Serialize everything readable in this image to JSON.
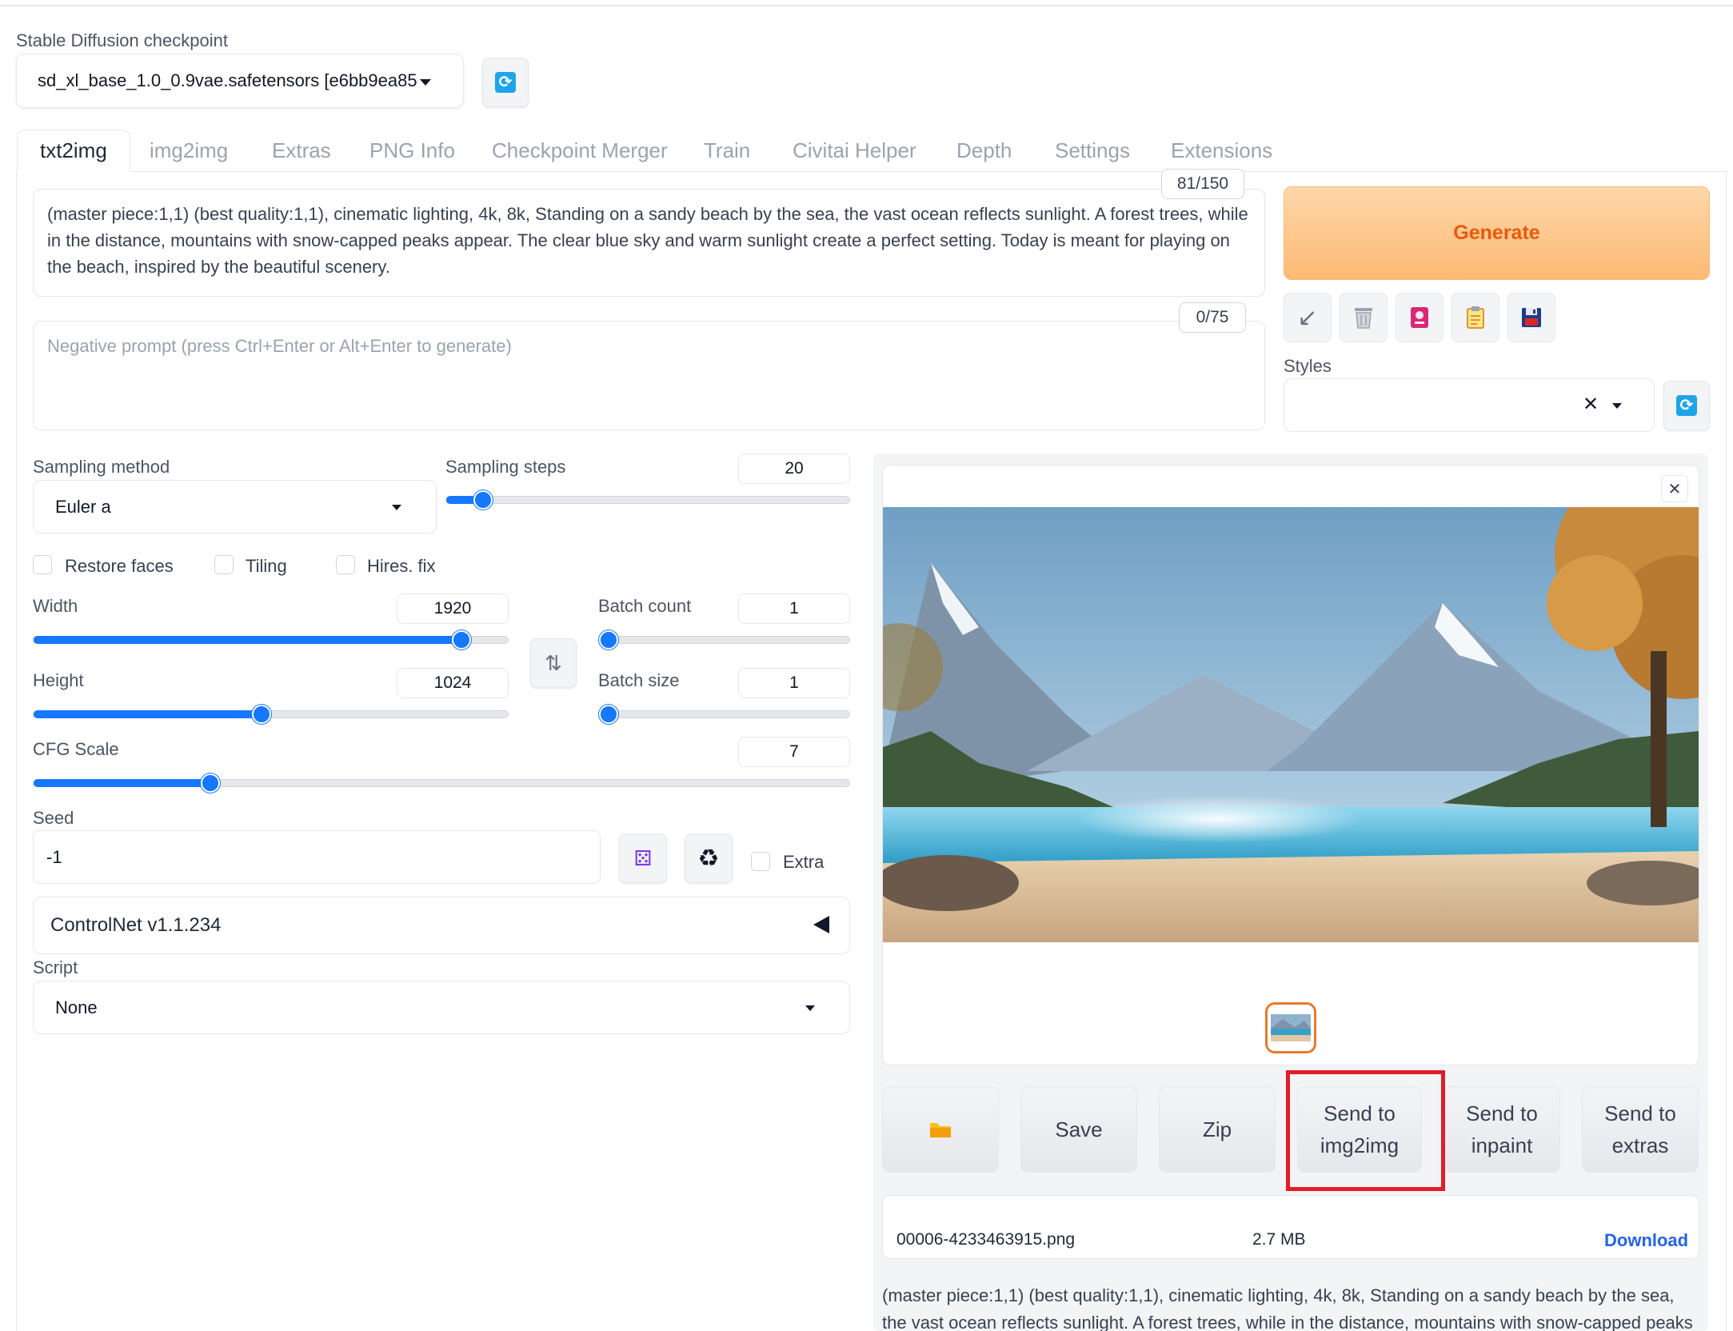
{
  "checkpoint": {
    "label": "Stable Diffusion checkpoint",
    "value": "sd_xl_base_1.0_0.9vae.safetensors [e6bb9ea85"
  },
  "tabs": [
    {
      "label": "txt2img",
      "active": true
    },
    {
      "label": "img2img"
    },
    {
      "label": "Extras"
    },
    {
      "label": "PNG Info"
    },
    {
      "label": "Checkpoint Merger"
    },
    {
      "label": "Train"
    },
    {
      "label": "Civitai Helper"
    },
    {
      "label": "Depth"
    },
    {
      "label": "Settings"
    },
    {
      "label": "Extensions"
    }
  ],
  "prompt": {
    "text": "(master piece:1,1) (best quality:1,1), cinematic lighting, 4k, 8k, Standing on a sandy beach by the sea, the vast ocean reflects sunlight. A forest trees, while in the distance, mountains with snow-capped peaks appear. The clear blue sky and warm sunlight create a perfect setting.  Today is meant for playing on the beach, inspired by the beautiful scenery.",
    "counter": "81/150"
  },
  "negative_prompt": {
    "placeholder": "Negative prompt (press Ctrl+Enter or Alt+Enter to generate)",
    "counter": "0/75"
  },
  "generate_label": "Generate",
  "styles": {
    "label": "Styles",
    "clear_symbol": "✕"
  },
  "sampling": {
    "method_label": "Sampling method",
    "method_value": "Euler a",
    "steps_label": "Sampling steps",
    "steps_value": "20",
    "steps_fraction": 0.07
  },
  "checkboxes": {
    "restore_faces": "Restore faces",
    "tiling": "Tiling",
    "hires_fix": "Hires. fix"
  },
  "width": {
    "label": "Width",
    "value": "1920",
    "fraction": 0.92
  },
  "height": {
    "label": "Height",
    "value": "1024",
    "fraction": 0.48
  },
  "batch_count": {
    "label": "Batch count",
    "value": "1",
    "fraction": 0.0
  },
  "batch_size": {
    "label": "Batch size",
    "value": "1",
    "fraction": 0.0
  },
  "cfg": {
    "label": "CFG Scale",
    "value": "7",
    "fraction": 0.21
  },
  "seed": {
    "label": "Seed",
    "value": "-1",
    "extra_label": "Extra"
  },
  "controlnet": {
    "label": "ControlNet v1.1.234"
  },
  "script": {
    "label": "Script",
    "value": "None"
  },
  "actions": {
    "save": "Save",
    "zip": "Zip",
    "send_img2img_line1": "Send to",
    "send_img2img_line2": "img2img",
    "send_inpaint_line1": "Send to",
    "send_inpaint_line2": "inpaint",
    "send_extras_line1": "Send to",
    "send_extras_line2": "extras"
  },
  "file": {
    "name": "00006-4233463915.png",
    "size": "2.7 MB",
    "download": "Download"
  },
  "info_text": "(master piece:1,1) (best quality:1,1), cinematic lighting, 4k, 8k, Standing on a sandy beach by the sea, the vast ocean reflects sunlight. A forest trees, while in the distance, mountains with snow-capped peaks",
  "colors": {
    "accent": "#1677ff",
    "generate_text": "#ea580c",
    "highlight": "#e11d2a",
    "download_link": "#2563eb"
  }
}
